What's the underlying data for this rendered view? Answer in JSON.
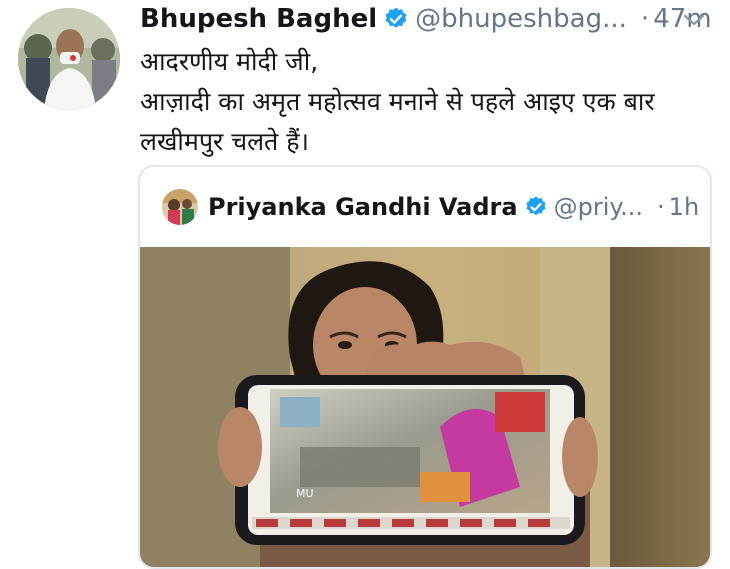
{
  "tweet": {
    "author_name": "Bhupesh Baghel",
    "author_handle": "@bhupeshbag...",
    "separator": "·",
    "time": "47m",
    "text": "आदरणीय मोदी जी,\nआज़ादी का अमृत महोत्सव मनाने से पहले आइए एक बार\nलखीमपुर चलते हैं।"
  },
  "quoted_tweet": {
    "author_name": "Priyanka Gandhi Vadra",
    "author_handle": "@priy...",
    "separator": "·",
    "time": "1h",
    "media_overlay_text": "MU"
  },
  "icons": {
    "verified": "verified-badge-icon",
    "menu": "chevron-down-icon"
  },
  "colors": {
    "text": "#14171a",
    "muted": "#657786",
    "verified": "#1da1f2",
    "border": "#e1e8ed"
  }
}
